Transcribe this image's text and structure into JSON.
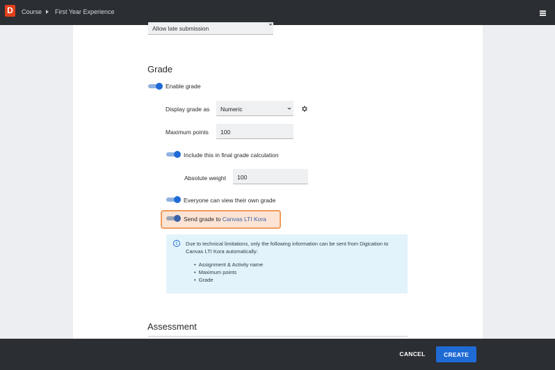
{
  "topbar": {
    "logo_letter": "D",
    "breadcrumb": [
      "Course",
      "First Year Experience"
    ]
  },
  "form": {
    "late_submission_select": "Allow late submission",
    "grade_section": {
      "title": "Grade",
      "enable_grade": {
        "label": "Enable grade",
        "on": true
      },
      "display_grade_as": {
        "label": "Display grade as",
        "value": "Numeric"
      },
      "maximum_points": {
        "label": "Maximum points",
        "value": "100"
      },
      "include_final": {
        "label": "Include this in final grade calculation",
        "on": true
      },
      "absolute_weight": {
        "label": "Absolute weight",
        "value": "100"
      },
      "everyone_view": {
        "label": "Everyone can view their own grade",
        "on": true
      },
      "send_grade": {
        "label_prefix": "Send grade to ",
        "link": "Canvas LTI Kora",
        "on": true
      }
    },
    "info_box": {
      "text": "Due to technical limitations, only the following information can be sent from Digication to Canvas LTI Kora automatically:",
      "items": [
        "Assignment & Activity name",
        "Maximum points",
        "Grade"
      ]
    },
    "assessment_title": "Assessment"
  },
  "footer": {
    "cancel_label": "CANCEL",
    "create_label": "CREATE"
  },
  "colors": {
    "accent": "#1e6bd6",
    "highlight_border": "#f29a59",
    "highlight_bg": "#fce3d4",
    "info_bg": "#e2f3fb",
    "topbar_bg": "#2b2e33",
    "logo": "#e2401c"
  }
}
